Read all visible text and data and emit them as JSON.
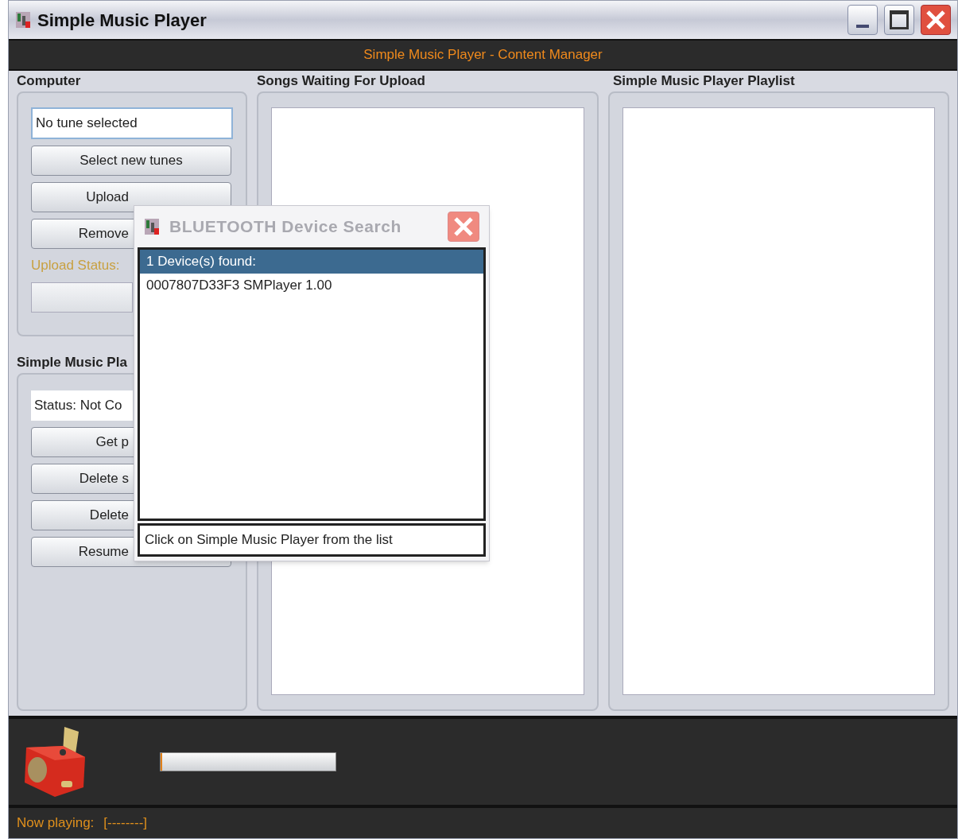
{
  "window": {
    "title": "Simple Music Player"
  },
  "header": {
    "title": "Simple Music Player - Content Manager"
  },
  "computer": {
    "title": "Computer",
    "field": "No tune selected",
    "buttons": [
      {
        "label": "Select new tunes",
        "cut": false
      },
      {
        "label": "Upload",
        "cut": true
      },
      {
        "label": "Remove",
        "cut": true
      }
    ],
    "status_label": "Upload Status:"
  },
  "player": {
    "title": "Simple Music Pla",
    "field": "Status: Not Co",
    "buttons": [
      {
        "label": "Get p",
        "cut": true
      },
      {
        "label": "Delete s",
        "cut": true
      },
      {
        "label": "Delete",
        "cut": true
      },
      {
        "label": "Resume",
        "cut": true
      }
    ]
  },
  "waiting": {
    "title": "Songs Waiting For Upload"
  },
  "playlist": {
    "title": "Simple Music Player Playlist"
  },
  "progress": {
    "level": 0.01
  },
  "upload_progress": {
    "level": 0
  },
  "status_bar": {
    "label": "Now playing:",
    "value": "[--------]"
  },
  "dialog": {
    "title": "BLUETOOTH Device Search",
    "items": [
      {
        "label": "1 Device(s) found:",
        "selected": true
      },
      {
        "label": "0007807D33F3 SMPlayer 1.00",
        "selected": false
      }
    ],
    "hint": "Click on Simple Music Player from the list"
  }
}
